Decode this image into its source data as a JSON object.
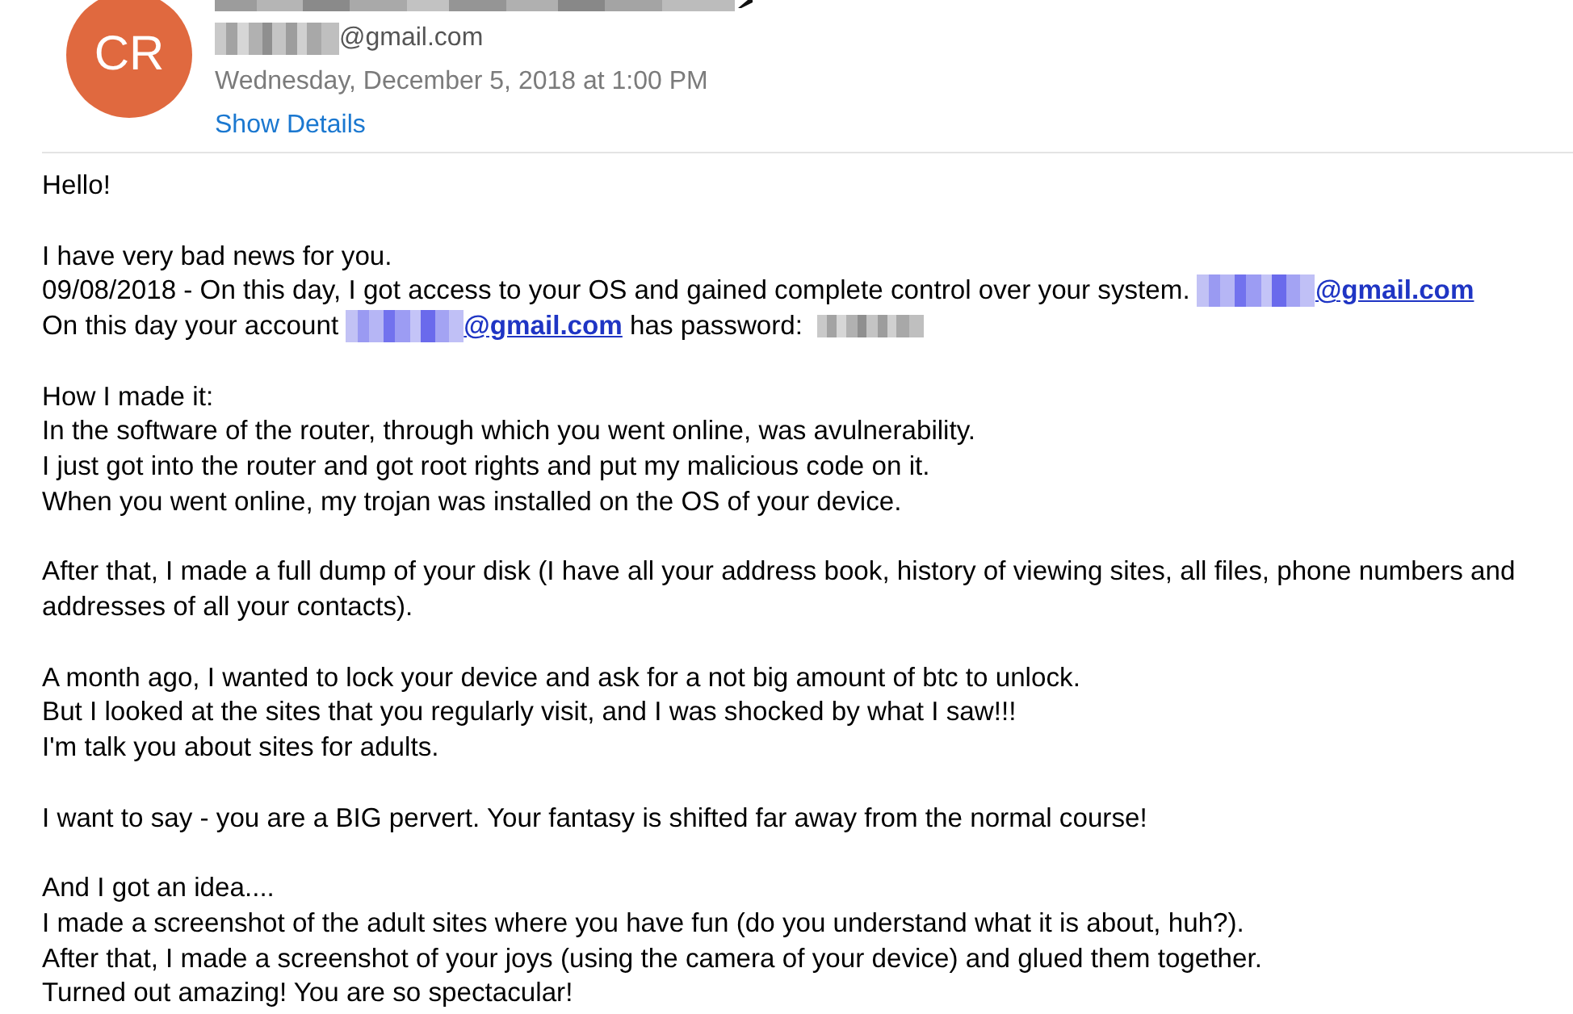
{
  "header": {
    "avatar": {
      "initials": "CR"
    },
    "name_line": [
      {
        "kind": "mask"
      }
    ],
    "address_line": [
      {
        "kind": "mask"
      },
      {
        "kind": "text",
        "text": "@gmail.com"
      }
    ],
    "date": "Wednesday, December 5, 2018 at 1:00 PM",
    "details_link": "Show Details"
  },
  "body": {
    "paragraphs": [
      {
        "lines": [
          {
            "text": "Hello!"
          }
        ]
      },
      {
        "lines": [
          {
            "text": "I have very bad news for you."
          },
          {
            "segments": [
              {
                "kind": "text",
                "text": "09/08/2018 - On this day, I got access to your OS and gained complete control over your system. "
              },
              {
                "kind": "linkmask"
              },
              {
                "kind": "link",
                "text": "@gmail.com"
              }
            ]
          },
          {
            "segments": [
              {
                "kind": "text",
                "text": "On this day your account "
              },
              {
                "kind": "linkmask"
              },
              {
                "kind": "link",
                "text": "@gmail.com"
              },
              {
                "kind": "text",
                "text": " has password: "
              },
              {
                "kind": "mask"
              }
            ]
          }
        ]
      },
      {
        "lines": [
          {
            "text": "How I made it:"
          },
          {
            "text": "In the software of the router, through which you went online, was avulnerability."
          },
          {
            "text": "I just got into the router and got root rights and put my malicious code on it."
          },
          {
            "text": "When you went online, my trojan was installed on the OS of your device."
          }
        ]
      },
      {
        "lines": [
          {
            "text": "After that, I made a full dump of your disk (I have all your address book, history of viewing sites, all files, phone numbers and addresses of all your contacts)."
          }
        ]
      },
      {
        "lines": [
          {
            "text": "A month ago, I wanted to lock your device and ask for a not big amount of btc to unlock."
          },
          {
            "text": "But I looked at the sites that you regularly visit, and I was shocked by what I saw!!!"
          },
          {
            "text": "I'm talk you about sites for adults."
          }
        ]
      },
      {
        "lines": [
          {
            "text": "I want to say - you are a BIG pervert. Your fantasy is shifted far away from the normal course!"
          }
        ]
      },
      {
        "lines": [
          {
            "text": "And I got an idea...."
          },
          {
            "text": "I made a screenshot of the adult sites where you have fun (do you understand what it is about, huh?)."
          },
          {
            "text": "After that, I made a screenshot of your joys (using the camera of your device) and glued them together."
          },
          {
            "text": "Turned out amazing! You are so spectacular!"
          }
        ]
      }
    ]
  }
}
